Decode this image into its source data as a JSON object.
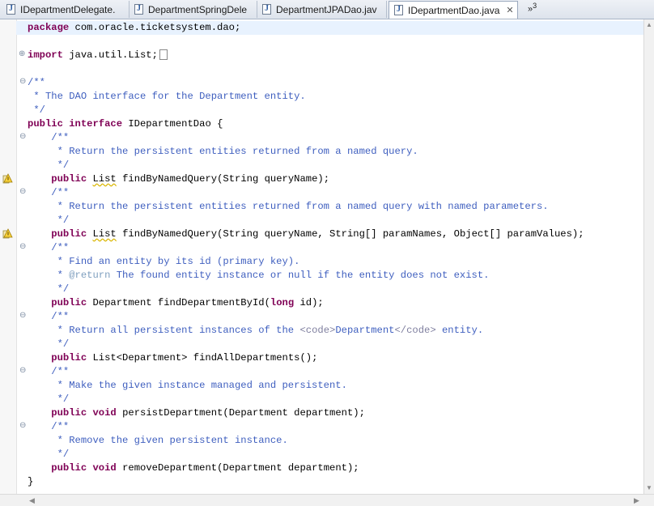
{
  "tabs": [
    {
      "label": "IDepartmentDelegate."
    },
    {
      "label": "DepartmentSpringDele"
    },
    {
      "label": "DepartmentJPADao.jav"
    },
    {
      "label": "IDepartmentDao.java",
      "close": "✕"
    }
  ],
  "tab_overflow": {
    "glyph": "»",
    "count": "3"
  },
  "code": {
    "l1": {
      "kw": "package",
      "rest": " com.oracle.ticketsystem.dao;"
    },
    "l2": {
      "kw": "import",
      "rest": " java.util.List;"
    },
    "l3": {
      "c": "/**"
    },
    "l4": {
      "c": " * The DAO interface for the Department entity."
    },
    "l5": {
      "c": " */"
    },
    "l6": {
      "kw1": "public",
      "kw2": "interface",
      "rest": " IDepartmentDao {"
    },
    "l7": {
      "c": "    /**"
    },
    "l8": {
      "c": "     * Return the persistent entities returned from a named query."
    },
    "l9": {
      "c": "     */"
    },
    "l10": {
      "kw": "public",
      "t": "List",
      "rest": " findByNamedQuery(String queryName);"
    },
    "l11": {
      "c": "    /**"
    },
    "l12": {
      "c": "     * Return the persistent entities returned from a named query with named parameters."
    },
    "l13": {
      "c": "     */"
    },
    "l14": {
      "kw": "public",
      "t": "List",
      "rest": " findByNamedQuery(String queryName, String[] paramNames, Object[] paramValues);"
    },
    "l15": {
      "c": "    /**"
    },
    "l16": {
      "c": "     * Find an entity by its id (primary key)."
    },
    "l17": {
      "pre": "     * ",
      "ann": "@return",
      "c": " The found entity instance or null if the entity does not exist."
    },
    "l18": {
      "c": "     */"
    },
    "l19": {
      "kw": "public",
      "rest": " Department findDepartmentById(",
      "kw2": "long",
      "rest2": " id);"
    },
    "l20": {
      "c": "    /**"
    },
    "l21": {
      "pre": "     * Return all persistent instances of the ",
      "tag1": "<code>",
      "mid": "Department",
      "tag2": "</code>",
      "post": " entity."
    },
    "l22": {
      "c": "     */"
    },
    "l23": {
      "kw": "public",
      "rest": " List<Department> findAllDepartments();"
    },
    "l24": {
      "c": "    /**"
    },
    "l25": {
      "c": "     * Make the given instance managed and persistent."
    },
    "l26": {
      "c": "     */"
    },
    "l27": {
      "kw": "public",
      "kw2": "void",
      "rest": " persistDepartment(Department department);"
    },
    "l28": {
      "c": "    /**"
    },
    "l29": {
      "c": "     * Remove the given persistent instance."
    },
    "l30": {
      "c": "     */"
    },
    "l31": {
      "kw": "public",
      "kw2": "void",
      "rest": " removeDepartment(Department department);"
    },
    "l32": {
      "rest": "}"
    }
  },
  "colors": {
    "keyword": "#7f0055",
    "comment": "#3f5fbf",
    "javadoc_tag": "#7f9fbf",
    "current_line": "#e8f2fe"
  }
}
